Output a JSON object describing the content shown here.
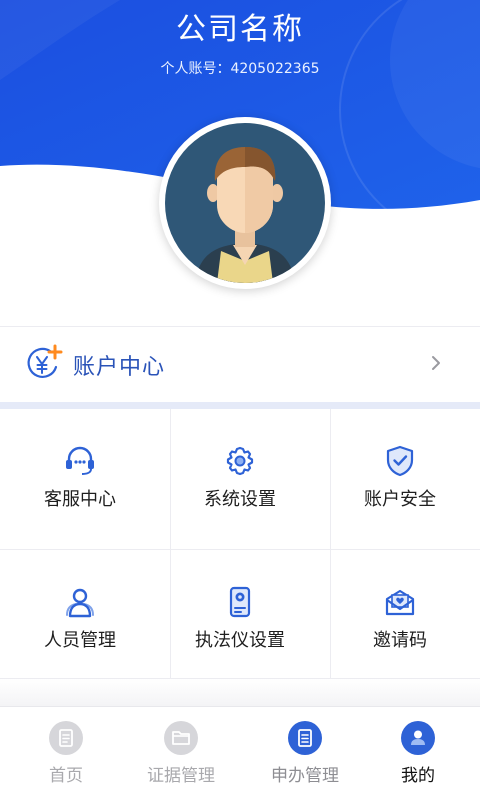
{
  "header": {
    "company_name": "公司名称",
    "account_label": "个人账号：",
    "account_number": "4205022365"
  },
  "account_center": {
    "label": "账户中心",
    "icon": "yen-coin-plus-icon"
  },
  "grid": [
    {
      "label": "客服中心",
      "icon": "headset-icon"
    },
    {
      "label": "系统设置",
      "icon": "gear-icon"
    },
    {
      "label": "账户安全",
      "icon": "shield-check-icon"
    },
    {
      "label": "人员管理",
      "icon": "user-group-icon"
    },
    {
      "label": "执法仪设置",
      "icon": "body-camera-icon"
    },
    {
      "label": "邀请码",
      "icon": "envelope-heart-icon"
    }
  ],
  "tabbar": [
    {
      "label": "首页",
      "icon": "document-icon",
      "state": "inactive"
    },
    {
      "label": "证据管理",
      "icon": "folder-icon",
      "state": "inactive"
    },
    {
      "label": "申办管理",
      "icon": "clipboard-icon",
      "state": "inactive"
    },
    {
      "label": "我的",
      "icon": "user-icon",
      "state": "active"
    }
  ],
  "colors": {
    "brand_blue": "#1c55e0",
    "accent_orange": "#ff8a1e",
    "icon_blue": "#2e62d6"
  }
}
